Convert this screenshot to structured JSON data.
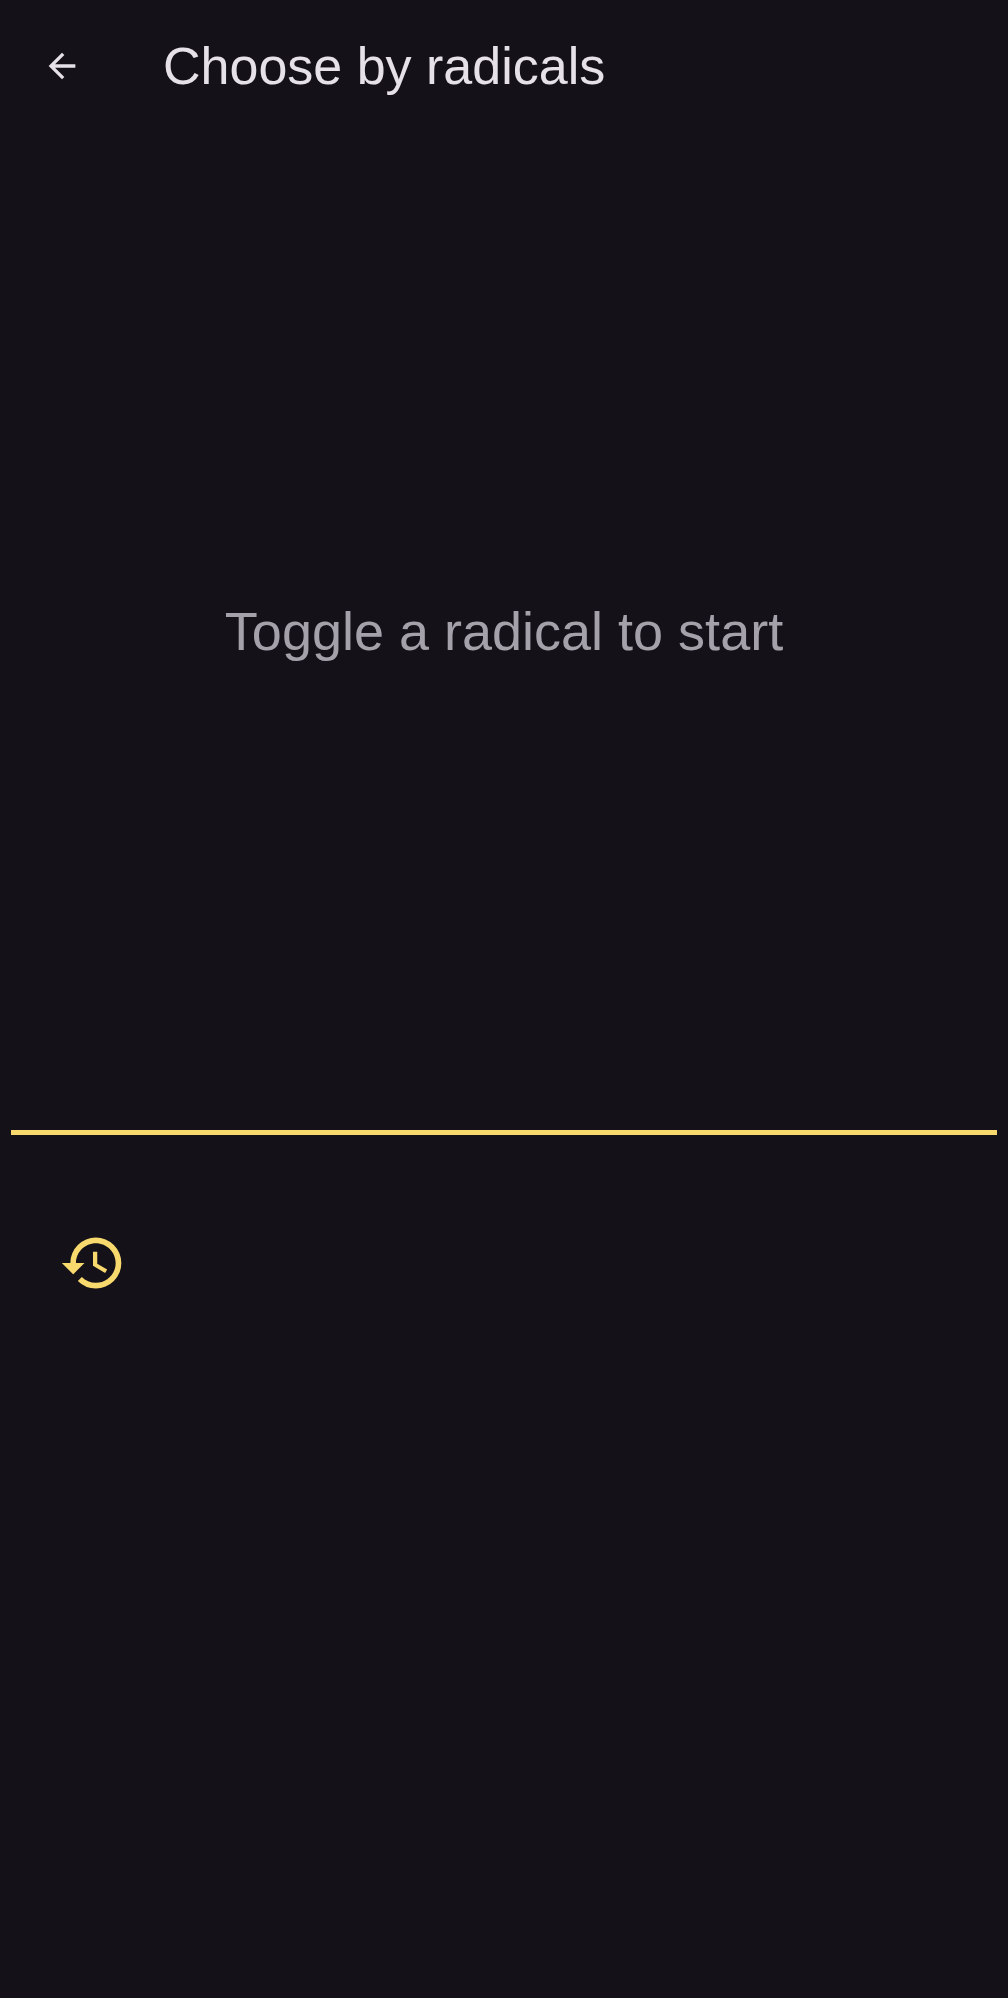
{
  "app_bar": {
    "title": "Choose by radicals"
  },
  "results": {
    "empty_message": "Toggle a radical to start"
  }
}
